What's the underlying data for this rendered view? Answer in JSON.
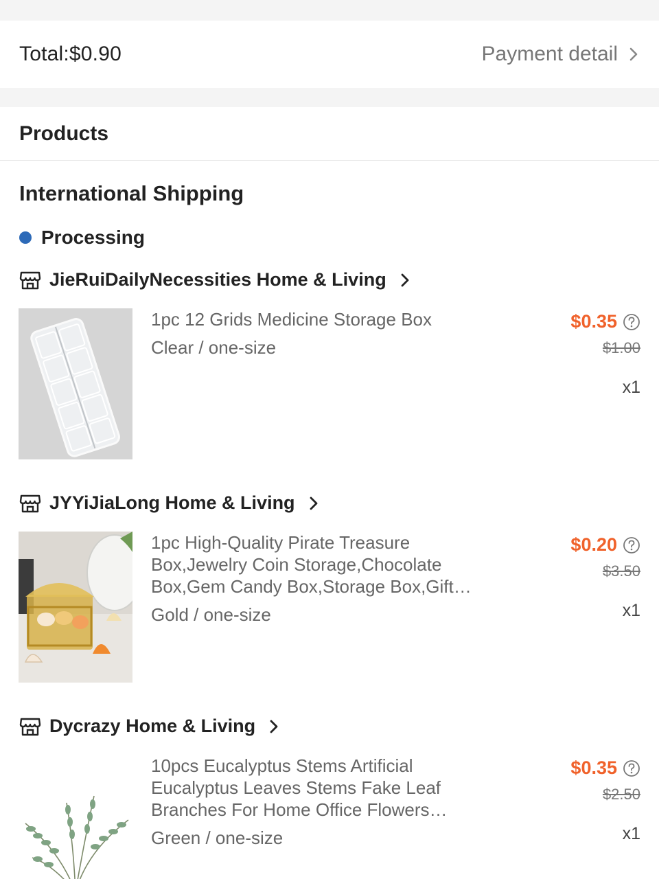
{
  "summary": {
    "total": "Total:$0.90",
    "payment_detail": "Payment detail"
  },
  "products": {
    "title": "Products",
    "shipping_title": "International Shipping",
    "status": "Processing",
    "status_color": "#2d6ab8",
    "price_color": "#f0622b",
    "stores": [
      {
        "name": "JieRuiDailyNecessities Home & Living",
        "item": {
          "title": "1pc 12 Grids Medicine Storage Box",
          "variant": "Clear / one-size",
          "price": "$0.35",
          "original_price": "$1.00",
          "quantity": "x1",
          "image_icon": "clear-pill-box"
        }
      },
      {
        "name": "JYYiJiaLong Home & Living",
        "item": {
          "title": "1pc High-Quality Pirate Treasure Box,Jewelry Coin Storage,Chocolate Box,Gem Candy Box,Storage Box,Gift Box",
          "variant": "Gold / one-size",
          "price": "$0.20",
          "original_price": "$3.50",
          "quantity": "x1",
          "image_icon": "gold-treasure-box"
        }
      },
      {
        "name": "Dycrazy Home & Living",
        "item": {
          "title": "10pcs Eucalyptus Stems Artificial Eucalyptus Leaves Stems Fake Leaf Branches For Home Office Flowers Decoration",
          "variant": "Green / one-size",
          "price": "$0.35",
          "original_price": "$2.50",
          "quantity": "x1",
          "image_icon": "eucalyptus-stems"
        }
      }
    ]
  }
}
